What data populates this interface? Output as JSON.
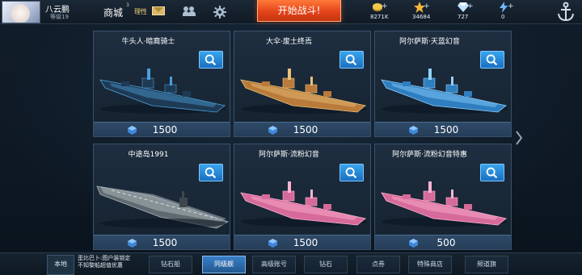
{
  "player": {
    "name": "八云鹏",
    "level": "等级19"
  },
  "nav": {
    "shop_label": "商城",
    "shop_badge": "3",
    "mail_label": "理性",
    "battle_label": "开始战斗!"
  },
  "resources": [
    {
      "name": "gold",
      "value": "8271K",
      "icon": "gold-coin-icon",
      "color": "#f2c84b"
    },
    {
      "name": "star",
      "value": "34684",
      "icon": "star-icon",
      "color": "#f5b638"
    },
    {
      "name": "diamond",
      "value": "727",
      "icon": "diamond-icon",
      "color": "#bfe3ff"
    },
    {
      "name": "energy",
      "value": "0",
      "icon": "lightning-icon",
      "color": "#6fb8ff"
    }
  ],
  "cards": [
    {
      "name": "牛头人·暗裔骑士",
      "price": "1500",
      "hull": "#1f3a55",
      "accent": "#4aa0d8",
      "type": "battleship"
    },
    {
      "name": "大伞·废土终焉",
      "price": "1500",
      "hull": "#b97a3a",
      "accent": "#e8c27a",
      "type": "battleship"
    },
    {
      "name": "阿尔萨斯·天蓝幻音",
      "price": "1500",
      "hull": "#2f7ec0",
      "accent": "#8fd3ff",
      "type": "battleship"
    },
    {
      "name": "中途岛1991",
      "price": "1500",
      "hull": "#5f6a70",
      "accent": "#a9b4ba",
      "type": "carrier"
    },
    {
      "name": "阿尔萨斯·流粉幻音",
      "price": "1500",
      "hull": "#d66a9a",
      "accent": "#ffb3d2",
      "type": "battleship"
    },
    {
      "name": "阿尔萨斯·流粉幻音特惠",
      "price": "500",
      "hull": "#d66a9a",
      "accent": "#ffb3d2",
      "type": "battleship"
    }
  ],
  "bottom": {
    "local_label": "本地",
    "ticker_line1": "歪比巴卜:图户装锁定",
    "ticker_line2": "不知黎船超值优惠",
    "tabs": [
      {
        "label": "钻石船",
        "active": false
      },
      {
        "label": "同级舰",
        "active": true
      },
      {
        "label": "高级账号",
        "active": false
      },
      {
        "label": "钻石",
        "active": false
      },
      {
        "label": "点券",
        "active": false
      },
      {
        "label": "特殊商店",
        "active": false
      },
      {
        "label": "频道旗",
        "active": false
      }
    ]
  }
}
